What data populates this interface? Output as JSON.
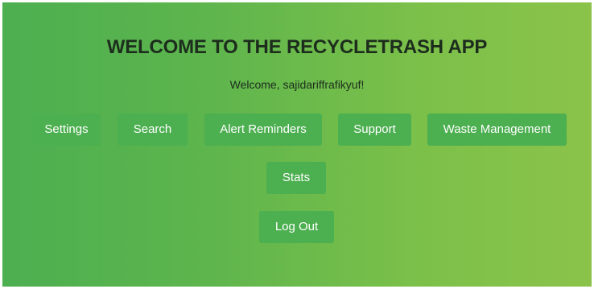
{
  "app": {
    "title": "WELCOME TO THE RECYCLETRASH APP",
    "welcome_message": "Welcome, sajidariffrafikyuf!"
  },
  "nav": {
    "buttons": [
      {
        "label": "Settings"
      },
      {
        "label": "Search"
      },
      {
        "label": "Alert Reminders"
      },
      {
        "label": "Support"
      },
      {
        "label": "Waste Management"
      },
      {
        "label": "Stats"
      }
    ],
    "logout_label": "Log Out"
  },
  "colors": {
    "gradient_start": "#4caf50",
    "gradient_end": "#8bc34a",
    "button": "#4caf50",
    "button_text": "#ffffff",
    "heading_text": "#1d2d1d"
  }
}
